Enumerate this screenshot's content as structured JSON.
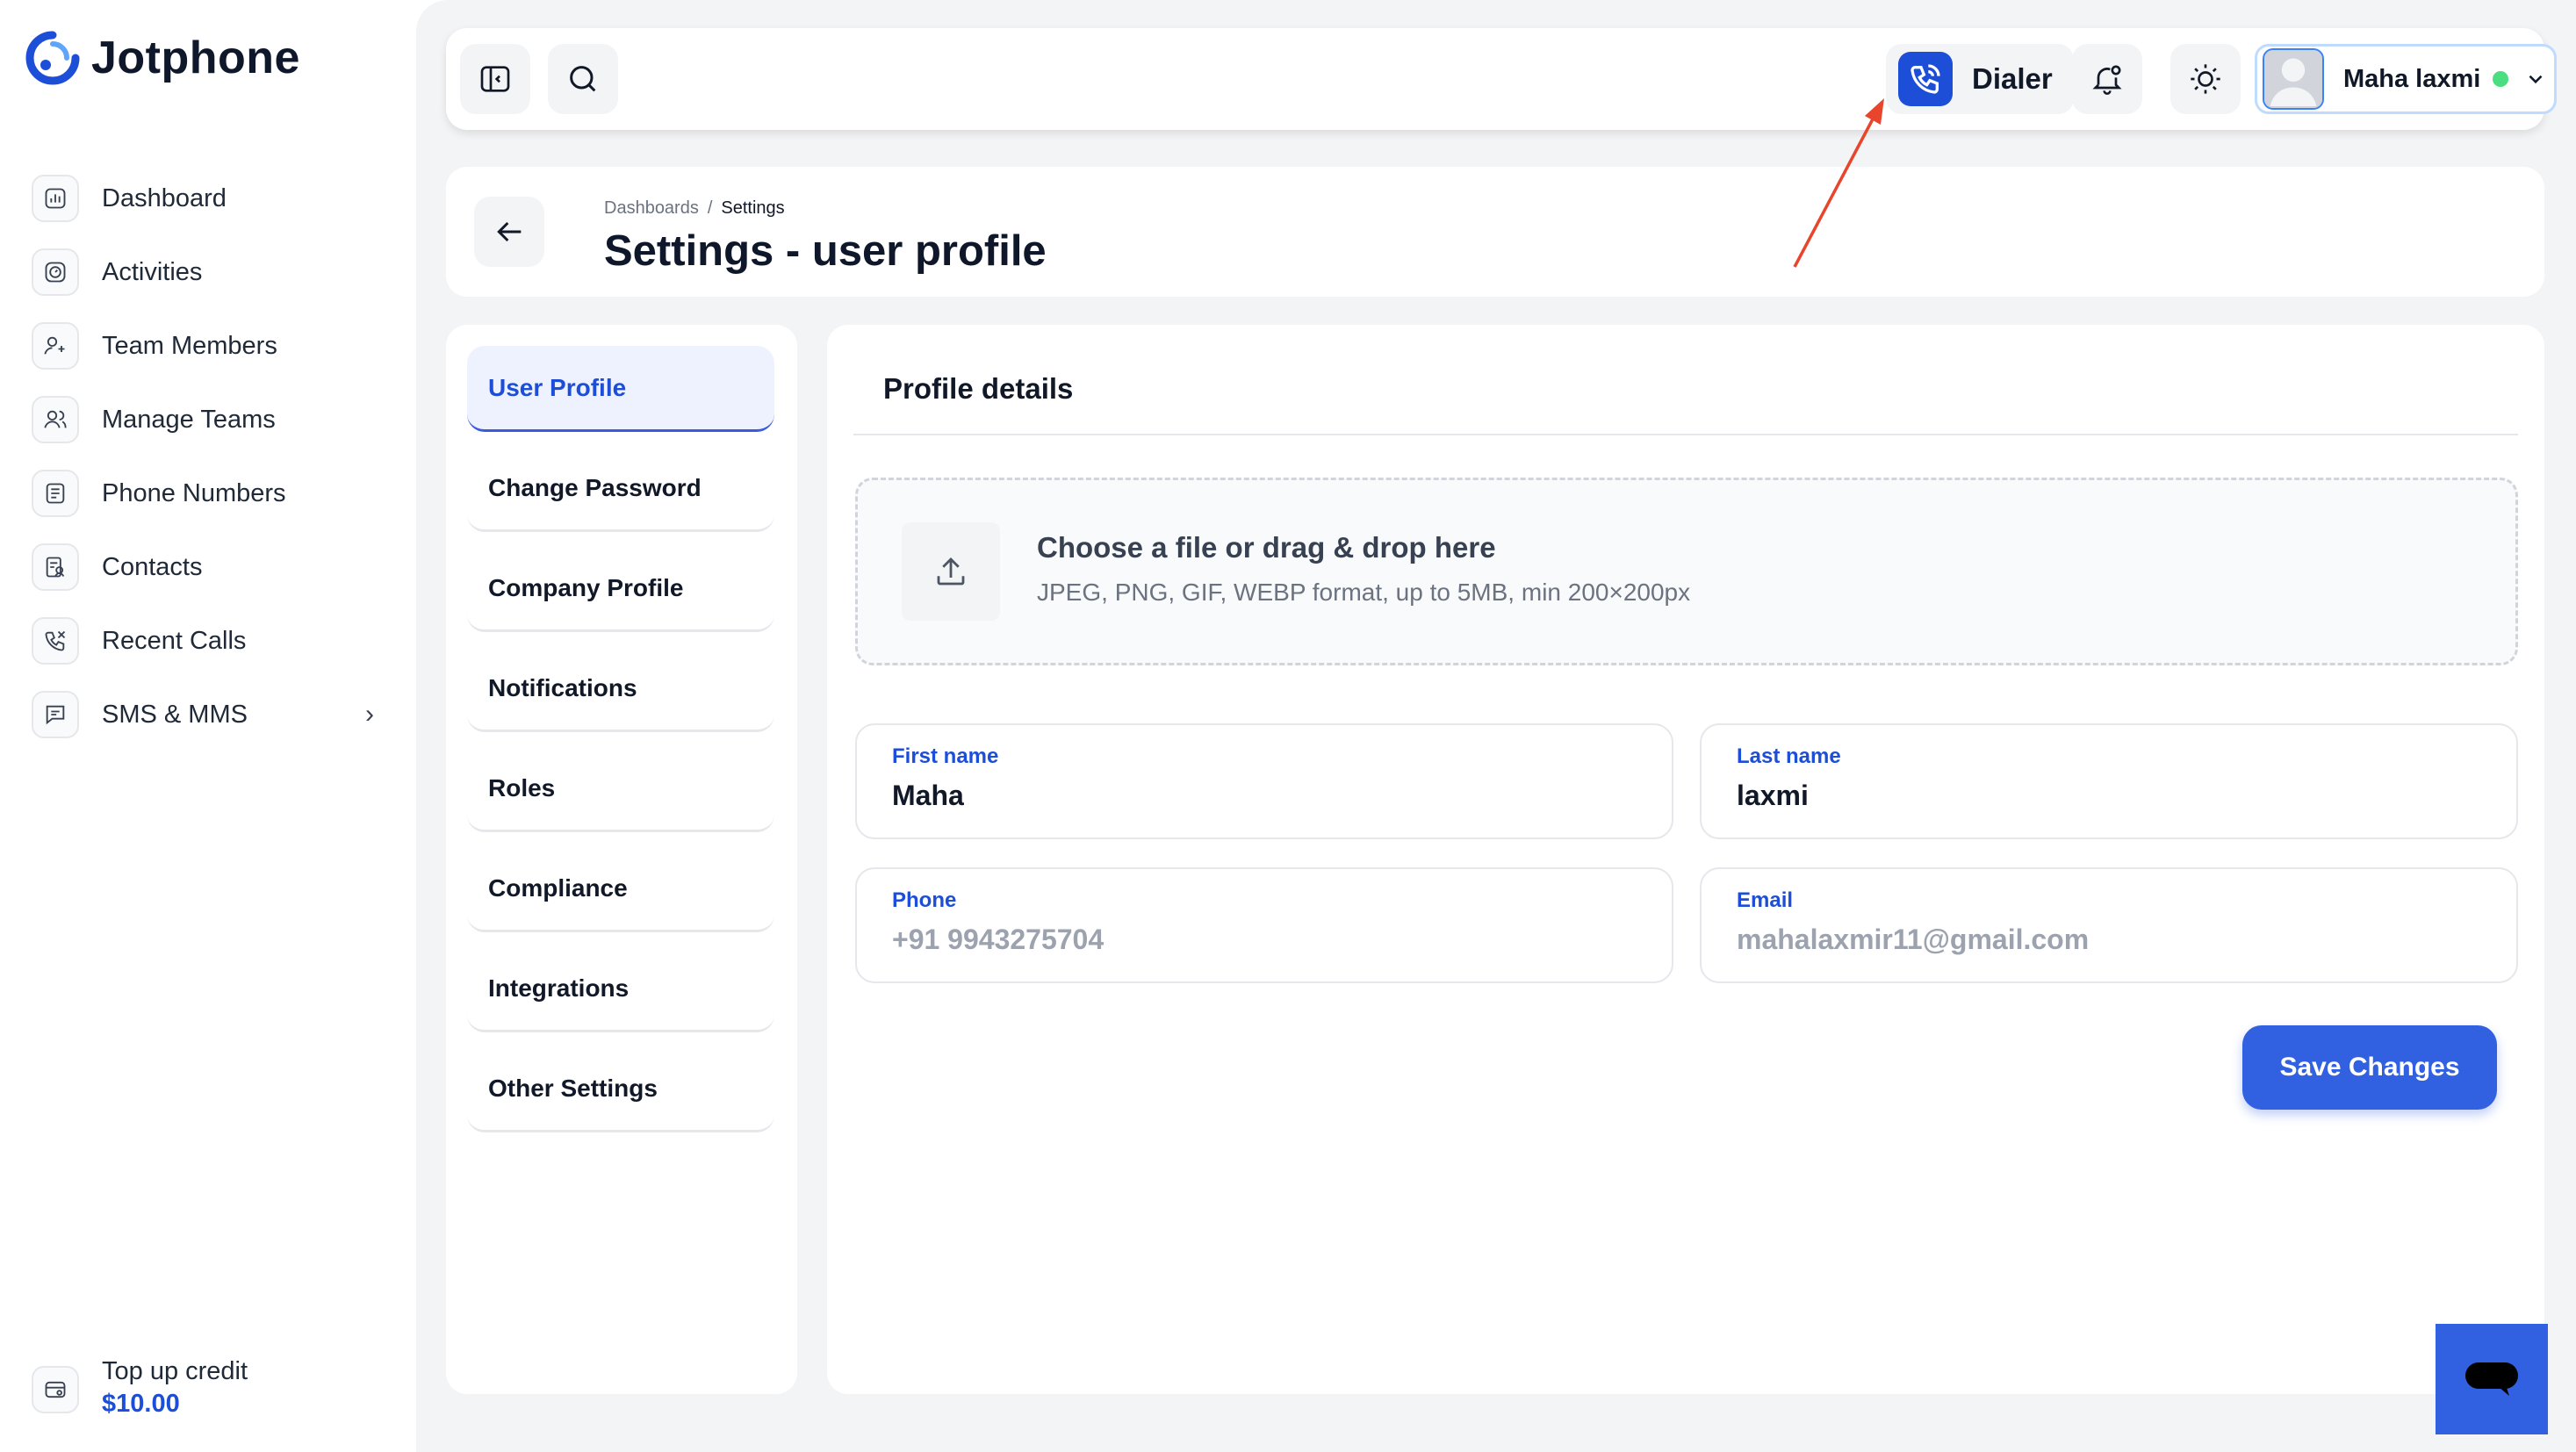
{
  "app": {
    "name": "Jotphone"
  },
  "sidebar": {
    "items": [
      {
        "label": "Dashboard",
        "icon": "dashboard-icon"
      },
      {
        "label": "Activities",
        "icon": "activities-icon"
      },
      {
        "label": "Team Members",
        "icon": "team-members-icon"
      },
      {
        "label": "Manage Teams",
        "icon": "manage-teams-icon"
      },
      {
        "label": "Phone Numbers",
        "icon": "phone-numbers-icon"
      },
      {
        "label": "Contacts",
        "icon": "contacts-icon"
      },
      {
        "label": "Recent Calls",
        "icon": "recent-calls-icon"
      },
      {
        "label": "SMS & MMS",
        "icon": "sms-icon",
        "expandable": true
      }
    ],
    "topup": {
      "title": "Top up credit",
      "amount": "$10.00"
    }
  },
  "topbar": {
    "dialer_label": "Dialer",
    "user": {
      "name": "Maha laxmi",
      "status": "online"
    }
  },
  "header": {
    "breadcrumb": [
      "Dashboards",
      "Settings"
    ],
    "breadcrumb_sep": "/",
    "title": "Settings - user profile"
  },
  "settings_menu": {
    "active": "User Profile",
    "items": [
      "User Profile",
      "Change Password",
      "Company Profile",
      "Notifications",
      "Roles",
      "Compliance",
      "Integrations",
      "Other Settings"
    ]
  },
  "profile": {
    "title": "Profile details",
    "upload": {
      "title": "Choose a file or drag & drop here",
      "hint": "JPEG, PNG, GIF, WEBP format, up to 5MB, min 200×200px"
    },
    "fields": {
      "first_name": {
        "label": "First name",
        "value": "Maha"
      },
      "last_name": {
        "label": "Last name",
        "value": "laxmi"
      },
      "phone": {
        "label": "Phone",
        "value": "+91 9943275704"
      },
      "email": {
        "label": "Email",
        "value": "mahalaxmir11@gmail.com"
      }
    },
    "save_label": "Save Changes"
  },
  "colors": {
    "accent": "#3161e0",
    "brand": "#1d4ed8",
    "online": "#4ade80",
    "annotation_arrow": "#e8452c"
  }
}
